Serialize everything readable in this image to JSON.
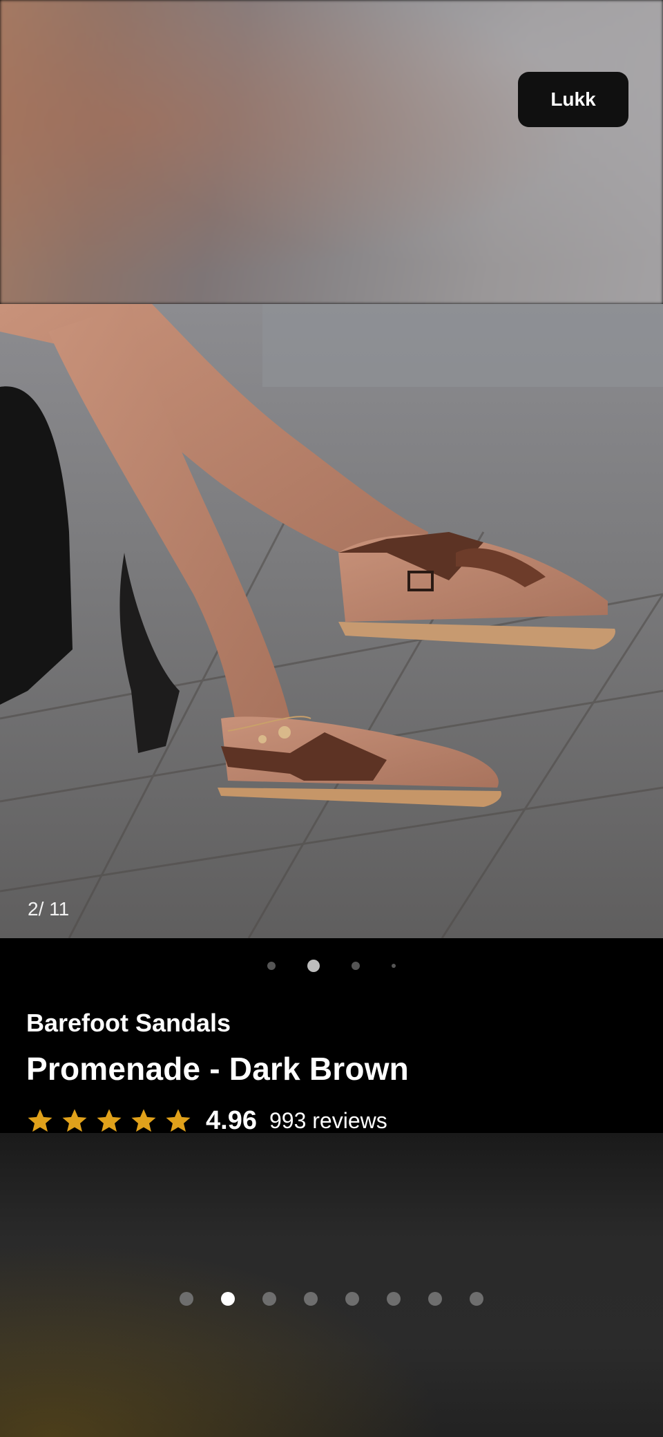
{
  "header": {
    "close_label": "Lukk"
  },
  "gallery": {
    "counter": "2/ 11",
    "photo_dots": {
      "count": 4,
      "active_index": 1
    },
    "page_dots": {
      "count": 8,
      "active_index": 1
    }
  },
  "product": {
    "brand": "Barefoot Sandals",
    "name": "Promenade - Dark Brown",
    "rating": "4.96",
    "reviews": "993 reviews",
    "star_color": "#e0a11b",
    "stars": 5
  }
}
